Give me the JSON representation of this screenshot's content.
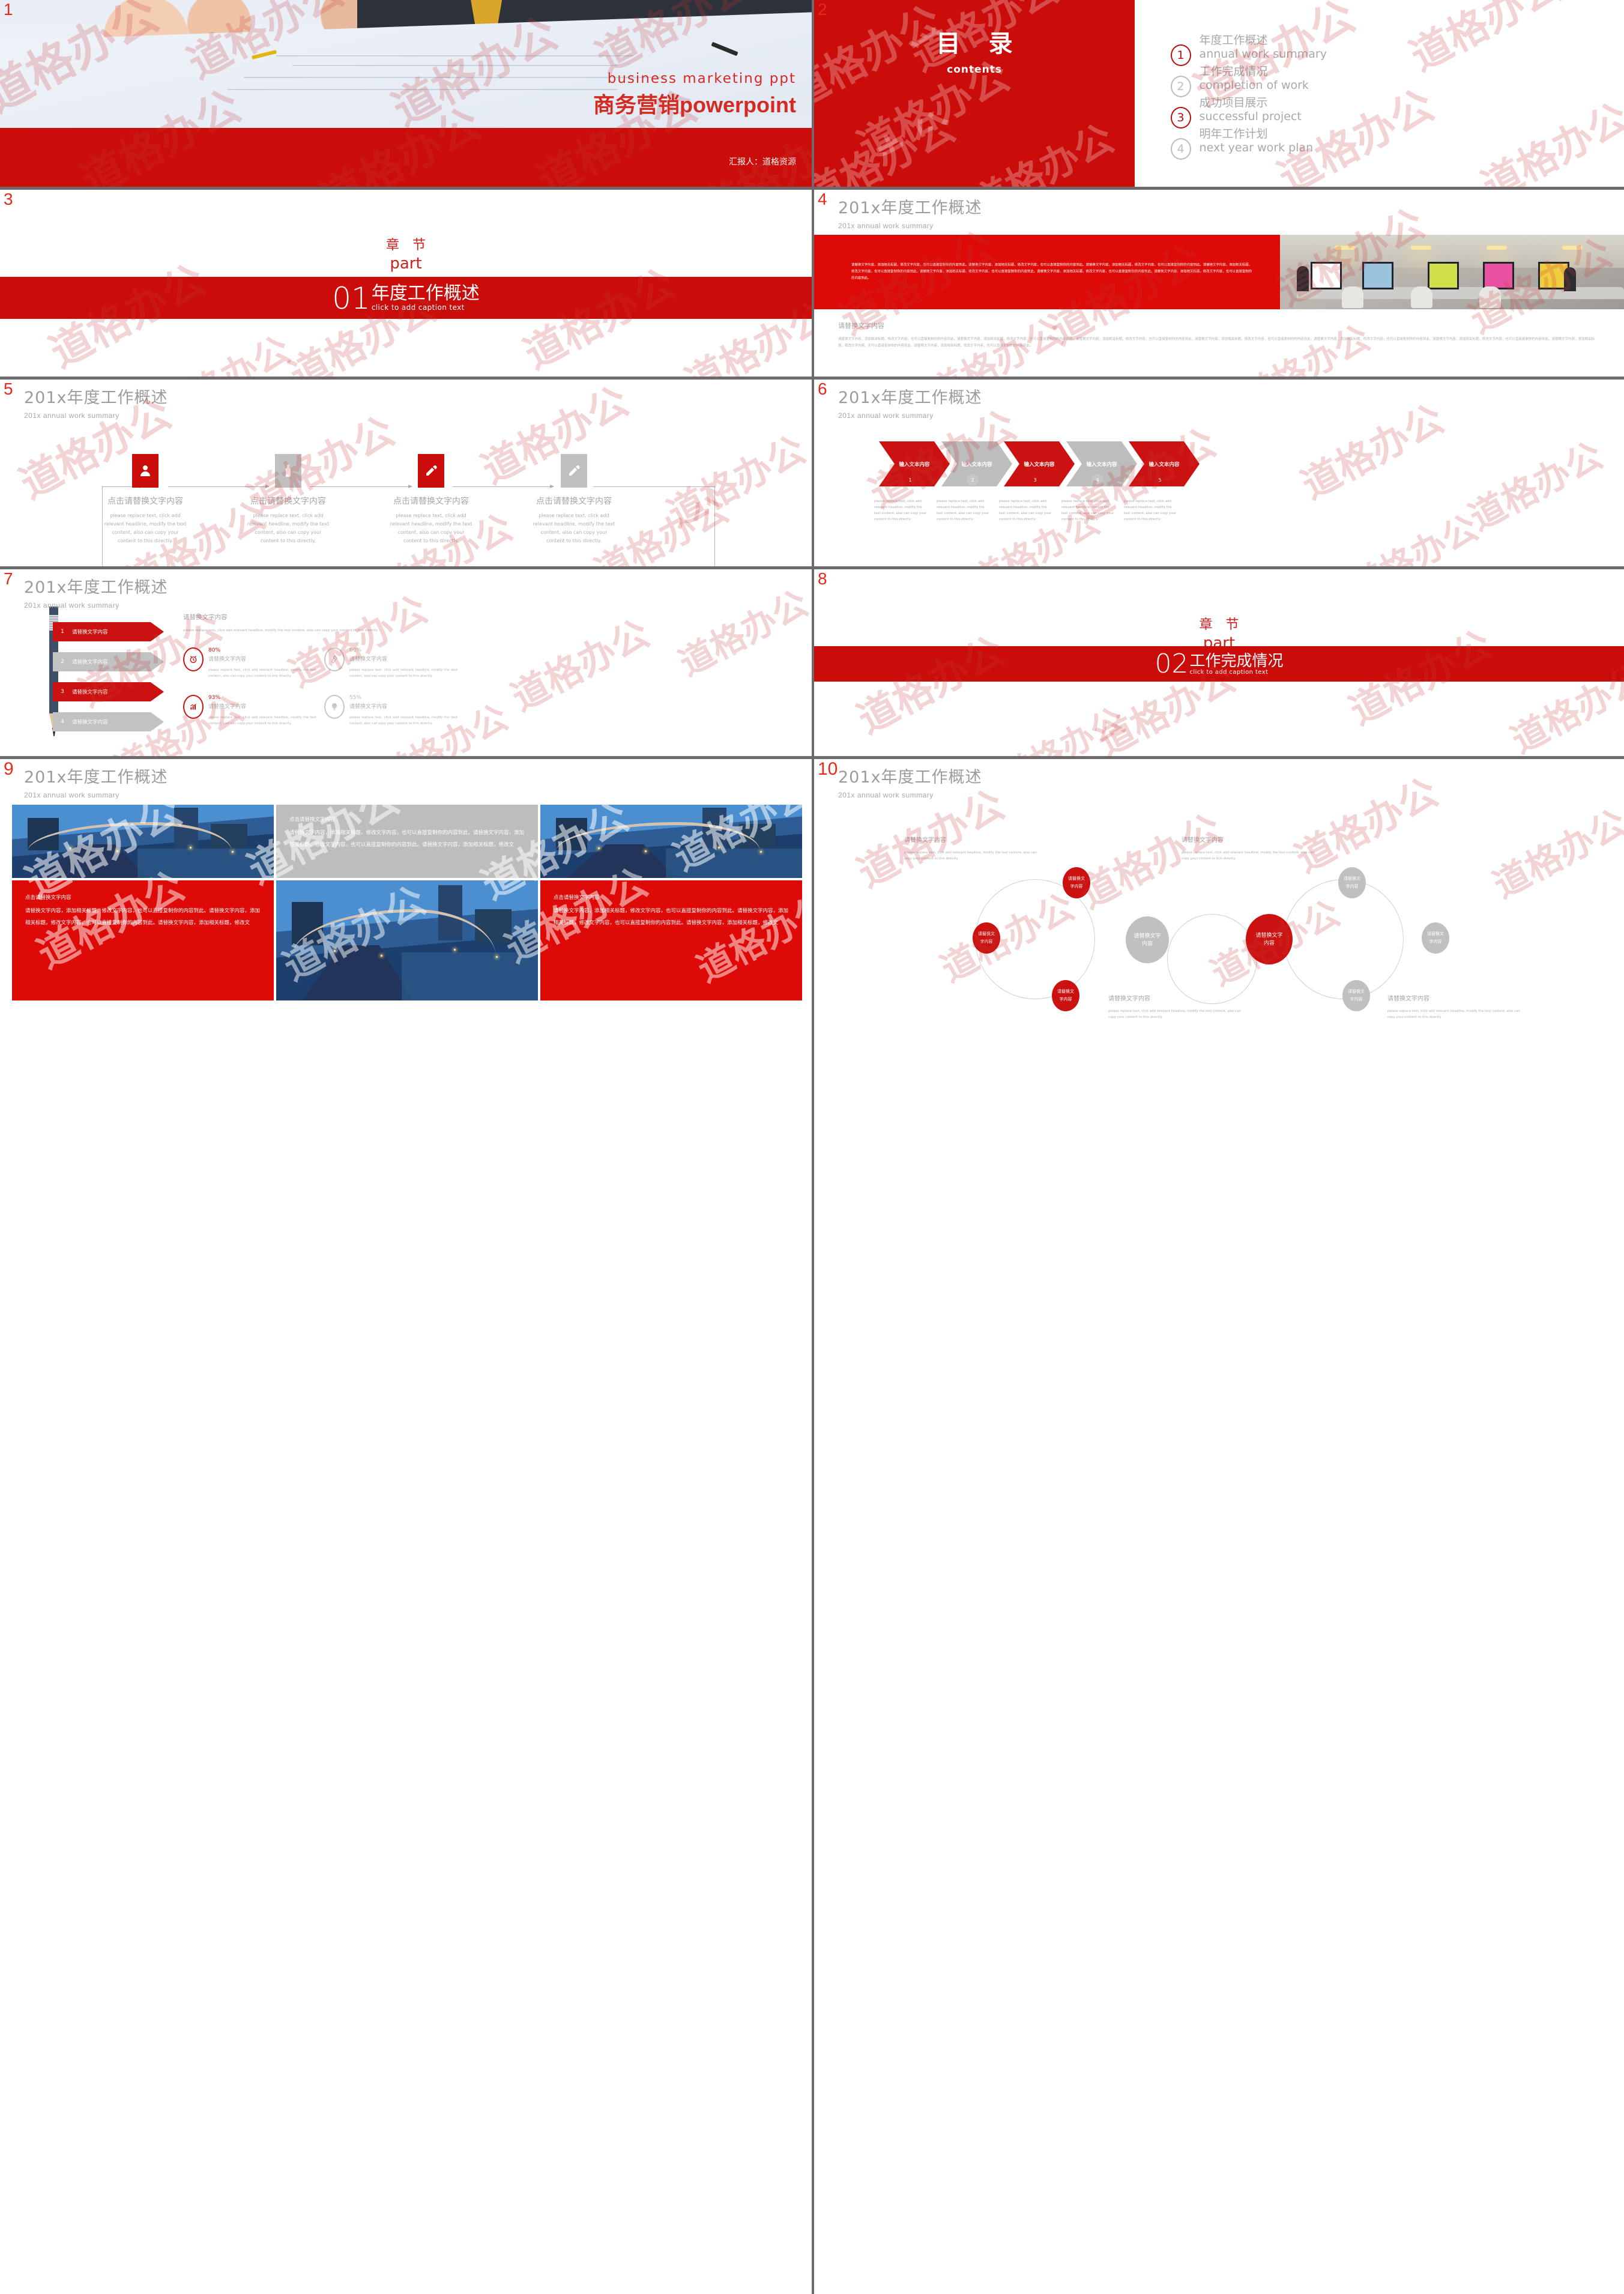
{
  "meta": {
    "accent_red": "#ca0d0a",
    "accent_red_bright": "#dd0a07",
    "gray": "#bdbdbd",
    "watermark_text": "道格办公"
  },
  "slides": [
    {
      "number": "1",
      "name": "title-slide",
      "english_subtitle": "business  marketing  ppt",
      "chinese_title": "商务营销powerpoint",
      "presenter": "汇报人：道格资源"
    },
    {
      "number": "2",
      "name": "contents-slide",
      "heading_cn": "目 录",
      "heading_en": "contents",
      "items": [
        {
          "num": "1",
          "cn": "年度工作概述",
          "en": "annual work summary",
          "active": true
        },
        {
          "num": "2",
          "cn": "工作完成情况",
          "en": "completion of work",
          "active": false
        },
        {
          "num": "3",
          "cn": "成功项目展示",
          "en": "successful project",
          "active": true
        },
        {
          "num": "4",
          "cn": "明年工作计划",
          "en": "next year work plan",
          "active": false
        }
      ]
    },
    {
      "number": "3",
      "name": "section-divider-01",
      "part_cn": "章 节",
      "part_en": "part",
      "section_no": "01",
      "section_cn": "年度工作概述",
      "section_en": "click to add caption text"
    },
    {
      "number": "4",
      "name": "annual-overview-photo",
      "title_cn": "201x年度工作概述",
      "title_en": "201x annual work summary",
      "red_paragraph": "请替换文字内容，添加相关标题，修改文字内容，也可以直接复制你的内容到此。请替换文字内容，添加相关标题，修改文字内容，也可以直接复制你的内容到此。请替换文字内容，添加相关标题，修改文字内容，也可以直接复制你的内容到此。请替换文字内容，添加相关标题，修改文字内容，也可以直接复制你的内容到此。请替换文字内容，添加相关标题，修改文字内容，也可以直接复制你的内容到此。请替换文字内容，添加相关标题，修改文字内容，也可以直接复制你的内容到此。请替换文字内容，添加相关标题，修改文字内容，也可以直接复制你的内容到此。",
      "sub_heading": "请替换文字内容",
      "sub_paragraph": "请替换文字内容，添加相关标题，修改文字内容，也可以直接复制你的内容到此。请替换文字内容，添加相关标题，修改文字内容，也可以直接复制你的内容到此。请替换文字内容，添加相关标题，修改文字内容，也可以直接复制你的内容到此。请替换文字内容，添加相关标题，修改文字内容，也可以直接复制你的内容到此。请替换文字内容，添加相关标题，修改文字内容，也可以直接复制你的内容到此。请替换文字内容，添加相关标题，修改文字内容，也可以直接复制你的内容到此。请替换文字内容，添加相关标题，修改文字内容，也可以直接复制你的内容到此。请替换文字内容，添加相关标题，修改文字内容，也可以直接复制你的内容到此。"
    },
    {
      "number": "5",
      "name": "process-flow-icons",
      "title_cn": "201x年度工作概述",
      "title_en": "201x annual work summary",
      "step_heading": "点击请替换文字内容",
      "step_body": "please replace text, click add relevant headline, modify the text content, also can copy your content to this directly.",
      "icons_top": [
        "user-icon",
        "bottle-icon",
        "flashlight-icon",
        "flashlight-icon"
      ],
      "icons_bottom": [
        "briefcase-icon",
        "lock-icon",
        "search-icon",
        "feather-icon"
      ],
      "colors_top": [
        "red",
        "gray",
        "red",
        "gray"
      ],
      "colors_bottom": [
        "red",
        "gray",
        "red",
        "gray"
      ]
    },
    {
      "number": "6",
      "name": "chevron-steps",
      "title_cn": "201x年度工作概述",
      "title_en": "201x annual work summary",
      "chevron_label": "输入文本内容",
      "chevron_body": "please replace text, click add relevant headline, modify the text content, also can copy your content to this directly.",
      "numbers": [
        "1",
        "2",
        "3",
        "4",
        "5"
      ],
      "colors": [
        "red",
        "gray",
        "red",
        "gray",
        "red"
      ]
    },
    {
      "number": "7",
      "name": "pencil-steps-stats",
      "title_cn": "201x年度工作概述",
      "title_en": "201x annual work summary",
      "arrows": [
        {
          "num": "1",
          "label": "请替换文字内容",
          "color": "red"
        },
        {
          "num": "2",
          "label": "请替换文字内容",
          "color": "gray"
        },
        {
          "num": "3",
          "label": "请替换文字内容",
          "color": "red"
        },
        {
          "num": "4",
          "label": "请替换文字内容",
          "color": "gray"
        }
      ],
      "right_heading": "请替换文字内容",
      "right_body": "please replace text, click add relevant headline, modify the text content, also can copy your content to this directly.",
      "stats": [
        {
          "pct": "80%",
          "label": "请替换文字内容",
          "icon": "alarm-clock-icon",
          "color": "red",
          "body": "please replace text, click add relevant headline, modify the text content, also can copy your content to this directly."
        },
        {
          "pct": "60%",
          "label": "请替换文字内容",
          "icon": "pen-nib-icon",
          "color": "gray",
          "body": "please replace text, click add relevant headline, modify the text content, also can copy your content to this directly."
        },
        {
          "pct": "93%",
          "label": "请替换文字内容",
          "icon": "growth-chart-icon",
          "color": "red",
          "body": "please replace text, click add relevant headline, modify the text content, also can copy your content to this directly."
        },
        {
          "pct": "55%",
          "label": "请替换文字内容",
          "icon": "lightbulb-icon",
          "color": "gray",
          "body": "please replace text, click add relevant headline, modify the text content, also can copy your content to this directly."
        }
      ]
    },
    {
      "number": "8",
      "name": "section-divider-02",
      "part_cn": "章 节",
      "part_en": "part",
      "section_no": "02",
      "section_cn": "工作完成情况",
      "section_en": "click to add caption text"
    },
    {
      "number": "9",
      "name": "image-text-grid",
      "title_cn": "201x年度工作概述",
      "title_en": "201x annual work summary",
      "cell_heading": "点击请替换文字内容",
      "cell_body": "请替换文字内容，添加相关标题，修改文字内容，也可以直接复制你的内容到此。请替换文字内容，添加相关标题，修改文字内容，也可以直接复制你的内容到此。请替换文字内容，添加相关标题，修改文"
    },
    {
      "number": "10",
      "name": "dual-circle-diagram",
      "title_cn": "201x年度工作概述",
      "title_en": "201x annual work summary",
      "captions": [
        {
          "h": "请替换文字内容",
          "b": "please replace text, click add relevant headline, modify the text content, also can copy your content to this directly."
        },
        {
          "h": "请替换文字内容",
          "b": "please replace text, click add relevant headline, modify the text content, also can copy your content to this directly."
        },
        {
          "h": "请替换文字内容",
          "b": "please replace text, click add relevant headline, modify the text content, also can copy your content to this directly."
        },
        {
          "h": "请替换文字内容",
          "b": "please replace text, click add relevant headline, modify the text content, also can copy your content to this directly."
        }
      ],
      "bubble_label": "请替换文字内容",
      "center_left_label": "请替换文字内容",
      "center_right_label": "请替换文字内容"
    }
  ]
}
